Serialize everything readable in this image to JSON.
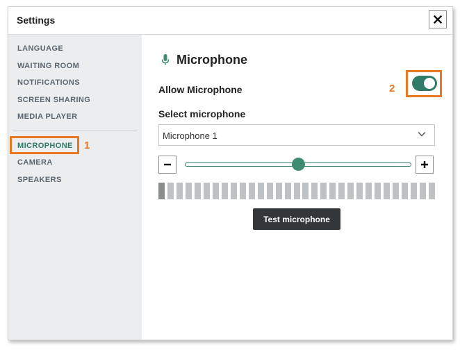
{
  "window": {
    "title": "Settings",
    "close_label": "✕"
  },
  "sidebar": {
    "items": [
      {
        "label": "LANGUAGE"
      },
      {
        "label": "WAITING ROOM"
      },
      {
        "label": "NOTIFICATIONS"
      },
      {
        "label": "SCREEN SHARING"
      },
      {
        "label": "MEDIA PLAYER"
      },
      {
        "label": "MICROPHONE",
        "active": true
      },
      {
        "label": "CAMERA"
      },
      {
        "label": "SPEAKERS"
      }
    ]
  },
  "callouts": {
    "one": "1",
    "two": "2",
    "color": "#e87722"
  },
  "panel": {
    "heading": "Microphone",
    "heading_icon": "microphone-icon",
    "allow_label": "Allow Microphone",
    "allow_on": true,
    "select_label": "Select microphone",
    "select_value": "Microphone 1",
    "volume_level_fraction": 0.5,
    "meter_segments": 31,
    "meter_lit_segments": 1,
    "test_button": "Test microphone"
  },
  "colors": {
    "accent": "#2f7d68",
    "callout": "#e87722",
    "dark_button": "#333739"
  }
}
